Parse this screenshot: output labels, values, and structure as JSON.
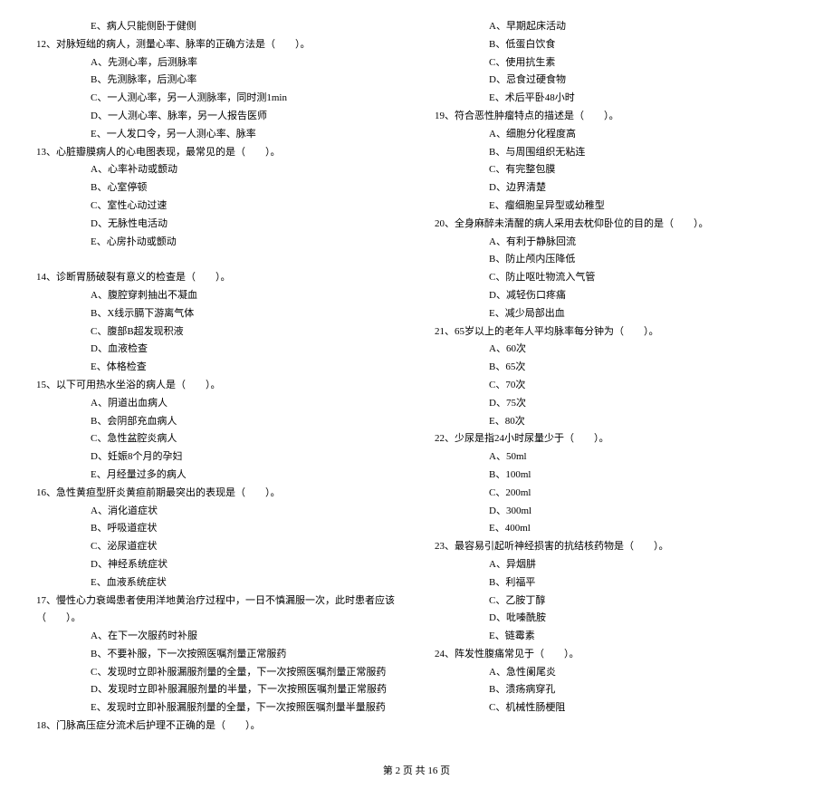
{
  "left": {
    "q11_optE": "E、病人只能侧卧于健侧",
    "q12": {
      "stem": "12、对脉短绌的病人，测量心率、脉率的正确方法是（　　）。",
      "A": "A、先测心率，后测脉率",
      "B": "B、先测脉率，后测心率",
      "C": "C、一人测心率，另一人测脉率，同时测1min",
      "D": "D、一人测心率、脉率，另一人报告医师",
      "E": "E、一人发口令，另一人测心率、脉率"
    },
    "q13": {
      "stem": "13、心脏瓣膜病人的心电图表现，最常见的是（　　）。",
      "A": "A、心率补动或颤动",
      "B": "B、心室停顿",
      "C": "C、室性心动过速",
      "D": "D、无脉性电活动",
      "E": "E、心房扑动或颤动"
    },
    "q14": {
      "stem": "14、诊断胃肠破裂有意义的检查是（　　）。",
      "A": "A、腹腔穿刺抽出不凝血",
      "B": "B、X线示膈下游离气体",
      "C": "C、腹部B超发现积液",
      "D": "D、血液检查",
      "E": "E、体格检查"
    },
    "q15": {
      "stem": "15、以下可用热水坐浴的病人是（　　）。",
      "A": "A、阴道出血病人",
      "B": "B、会阴部充血病人",
      "C": "C、急性盆腔炎病人",
      "D": "D、妊娠8个月的孕妇",
      "E": "E、月经量过多的病人"
    },
    "q16": {
      "stem": "16、急性黄疸型肝炎黄疸前期最突出的表现是（　　）。",
      "A": "A、消化道症状",
      "B": "B、呼吸道症状",
      "C": "C、泌尿道症状",
      "D": "D、神经系统症状",
      "E": "E、血液系统症状"
    },
    "q17": {
      "stem": "17、慢性心力衰竭患者使用洋地黄治疗过程中，一日不慎漏服一次，此时患者应该（　　）。",
      "A": "A、在下一次服药时补服",
      "B": "B、不要补服，下一次按照医嘱剂量正常服药",
      "C": "C、发现时立即补服漏服剂量的全量，下一次按照医嘱剂量正常服药",
      "D": "D、发现时立即补服漏服剂量的半量，下一次按照医嘱剂量正常服药",
      "E": "E、发现时立即补服漏服剂量的全量，下一次按照医嘱剂量半量服药"
    },
    "q18": {
      "stem": "18、门脉高压症分流术后护理不正确的是（　　）。"
    }
  },
  "right": {
    "q18_opts": {
      "A": "A、早期起床活动",
      "B": "B、低蛋白饮食",
      "C": "C、使用抗生素",
      "D": "D、忌食过硬食物",
      "E": "E、术后平卧48小时"
    },
    "q19": {
      "stem": "19、符合恶性肿瘤特点的描述是（　　）。",
      "A": "A、细胞分化程度高",
      "B": "B、与周围组织无粘连",
      "C": "C、有完整包膜",
      "D": "D、边界清楚",
      "E": "E、瘤细胞呈异型或幼稚型"
    },
    "q20": {
      "stem": "20、全身麻醉未清醒的病人采用去枕仰卧位的目的是（　　）。",
      "A": "A、有利于静脉回流",
      "B": "B、防止颅内压降低",
      "C": "C、防止呕吐物流入气管",
      "D": "D、减轻伤口疼痛",
      "E": "E、减少局部出血"
    },
    "q21": {
      "stem": "21、65岁以上的老年人平均脉率每分钟为（　　）。",
      "A": "A、60次",
      "B": "B、65次",
      "C": "C、70次",
      "D": "D、75次",
      "E": "E、80次"
    },
    "q22": {
      "stem": "22、少尿是指24小时尿量少于（　　）。",
      "A": "A、50ml",
      "B": "B、100ml",
      "C": "C、200ml",
      "D": "D、300ml",
      "E": "E、400ml"
    },
    "q23": {
      "stem": "23、最容易引起听神经损害的抗结核药物是（　　）。",
      "A": "A、异烟肼",
      "B": "B、利福平",
      "C": "C、乙胺丁醇",
      "D": "D、吡嗪酰胺",
      "E": "E、链霉素"
    },
    "q24": {
      "stem": "24、阵发性腹痛常见于（　　）。",
      "A": "A、急性阑尾炎",
      "B": "B、溃疡病穿孔",
      "C": "C、机械性肠梗阻"
    }
  },
  "footer": "第 2 页 共 16 页"
}
